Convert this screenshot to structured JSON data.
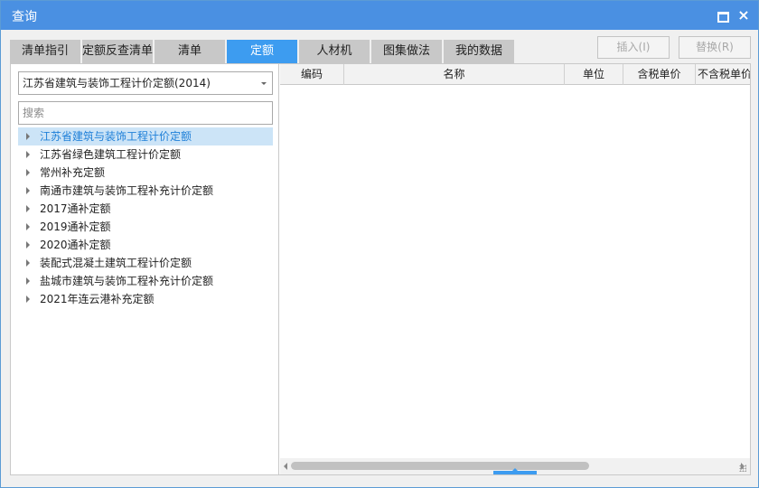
{
  "window": {
    "title": "查询"
  },
  "tabs": [
    {
      "label": "清单指引"
    },
    {
      "label": "定额反查清单"
    },
    {
      "label": "清单"
    },
    {
      "label": "定额"
    },
    {
      "label": "人材机"
    },
    {
      "label": "图集做法"
    },
    {
      "label": "我的数据"
    }
  ],
  "actions": {
    "insert": "插入(I)",
    "replace": "替换(R)"
  },
  "library": {
    "selected": "江苏省建筑与装饰工程计价定额(2014)"
  },
  "search": {
    "placeholder": "搜索",
    "value": ""
  },
  "tree": [
    {
      "label": "江苏省建筑与装饰工程计价定额"
    },
    {
      "label": "江苏省绿色建筑工程计价定额"
    },
    {
      "label": "常州补充定额"
    },
    {
      "label": "南通市建筑与装饰工程补充计价定额"
    },
    {
      "label": "2017通补定额"
    },
    {
      "label": "2019通补定额"
    },
    {
      "label": "2020通补定额"
    },
    {
      "label": "装配式混凝土建筑工程计价定额"
    },
    {
      "label": "盐城市建筑与装饰工程补充计价定额"
    },
    {
      "label": "2021年连云港补充定额"
    }
  ],
  "table": {
    "columns": [
      {
        "label": "编码"
      },
      {
        "label": "名称"
      },
      {
        "label": "单位"
      },
      {
        "label": "含税单价"
      },
      {
        "label": "不含税单价"
      }
    ],
    "rows": []
  },
  "colors": {
    "titlebar": "#4a90e2",
    "active_tab": "#3d9cf0",
    "selected_item": "#cce4f7"
  }
}
